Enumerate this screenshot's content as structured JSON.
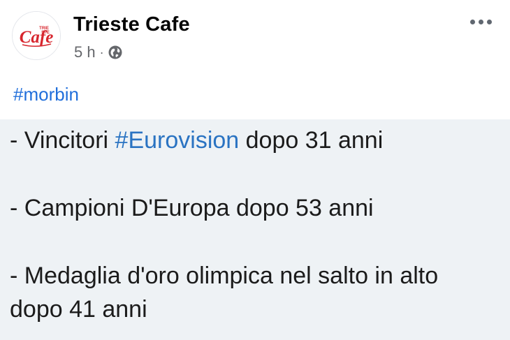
{
  "post": {
    "page_name": "Trieste Cafe",
    "timestamp": "5 h",
    "separator": "·",
    "privacy_icon": "globe-icon",
    "more_icon": "more-options-icon",
    "hashtag": "#morbin"
  },
  "avatar": {
    "logo_word": "Cafe",
    "logo_small_top": "TRIE",
    "logo_small_bottom": "STE"
  },
  "image_text": {
    "line1_prefix": "- Vincitori ",
    "line1_tag": "#Eurovision",
    "line1_suffix": " dopo 31 anni",
    "line2": "- Campioni D'Europa dopo 53 anni",
    "line3a": "- Medaglia d'oro olimpica nel salto in alto",
    "line3b": "dopo 41 anni"
  },
  "colors": {
    "hashtag": "#216fdb",
    "logo_red": "#d7262e",
    "image_background": "#eef2f5"
  }
}
